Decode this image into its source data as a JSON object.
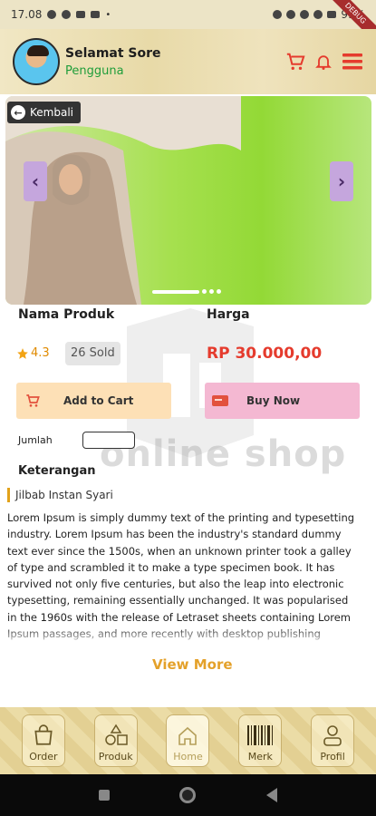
{
  "status_bar": {
    "time": "17.08",
    "battery": "99%",
    "debug_label": "DEBUG"
  },
  "header": {
    "greeting": "Selamat Sore",
    "user_role": "Pengguna"
  },
  "banner": {
    "back_label": "Kembali",
    "slide_count": 4,
    "active_slide": 1
  },
  "product": {
    "name_label": "Nama Produk",
    "price_label": "Harga",
    "rating": "4.3",
    "sold": "26 Sold",
    "price": "RP 30.000,00",
    "add_to_cart": "Add to Cart",
    "buy_now": "Buy Now",
    "qty_label": "Jumlah",
    "qty_value": ""
  },
  "watermark": {
    "text": "online shop"
  },
  "description": {
    "title": "Keterangan",
    "subtitle": "Jilbab Instan Syari",
    "body": "Lorem Ipsum is simply dummy text of the printing and typesetting industry. Lorem Ipsum has been the industry's standard dummy text ever since the 1500s, when an unknown printer took a galley of type and scrambled it to make a type specimen book. It has survived not only five centuries, but also the leap into electronic typesetting, remaining essentially unchanged. It was popularised in the 1960s with the release of Letraset sheets containing Lorem Ipsum passages, and more recently with desktop publishing software like Aldus PageMaker including versions of Lorem Ipsum.",
    "view_more": "View More"
  },
  "bottom_nav": {
    "items": [
      {
        "label": "Order",
        "icon": "bag-icon"
      },
      {
        "label": "Produk",
        "icon": "shapes-icon"
      },
      {
        "label": "Home",
        "icon": "home-icon"
      },
      {
        "label": "Merk",
        "icon": "barcode-icon"
      },
      {
        "label": "Profil",
        "icon": "person-icon"
      }
    ]
  },
  "colors": {
    "accent_red": "#e53b2d",
    "green": "#1f9d3a",
    "gold": "#e4a12a",
    "cart_bg": "#fde0b6",
    "buy_bg": "#f4b8d2"
  }
}
